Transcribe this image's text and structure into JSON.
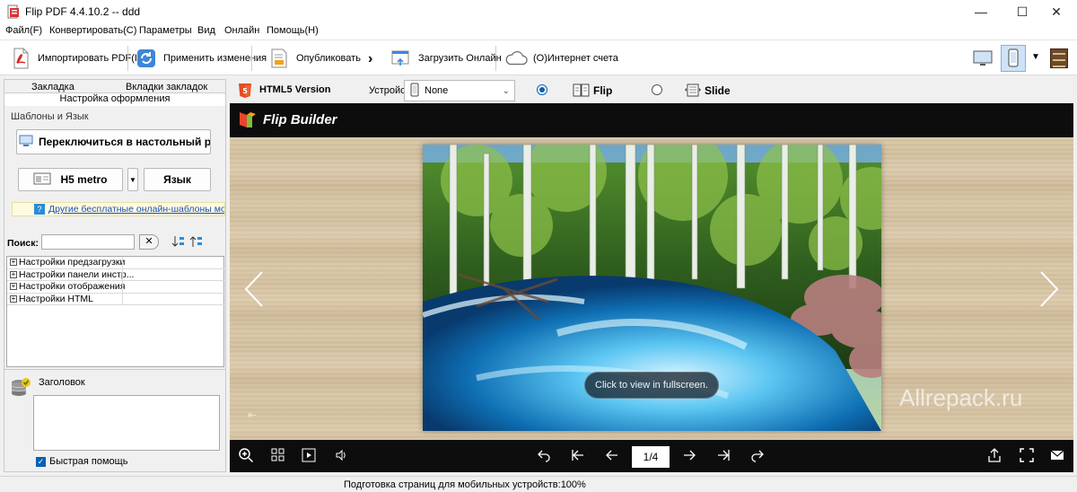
{
  "window": {
    "title": "Flip PDF 4.4.10.2 -- ddd",
    "minimize": "—",
    "maximize": "☐",
    "close": "✕"
  },
  "menu": [
    "Файл(F)",
    "Конвертировать(C)",
    "Параметры",
    "Вид",
    "Онлайн",
    "Помощь(H)"
  ],
  "toolbar": {
    "import_pdf": "Импортировать PDF(I)",
    "apply_changes": "Применить изменения",
    "publish": "Опубликовать",
    "upload_online": "Загрузить Онлайн",
    "online_account": "(O)Интернет счета"
  },
  "left_panel": {
    "tabs": [
      "Закладка",
      "Вкладки закладок",
      "Настройка оформления"
    ],
    "templates_group": "Шаблоны и Язык",
    "switch_desktop": "Переключиться в настольный реж",
    "template_name": "H5 metro",
    "language": "Язык",
    "online_templates_link": "Другие бесплатные онлайн-шаблоны можно н",
    "search_label": "Поиск:",
    "search_value": "",
    "tree": [
      "Настройки предзагрузки",
      "Настройки панели инстр...",
      "Настройки отображения",
      "Настройки HTML"
    ],
    "help_title": "Заголовок",
    "help_text": "",
    "quick_help": "Быстрая помощь",
    "quick_help_checked": true
  },
  "preview_settings": {
    "html5_version": "HTML5 Version",
    "device_label": "Устройст",
    "device_value": "None",
    "mode_flip": "Flip",
    "mode_slide": "Slide",
    "selected_mode": "Flip"
  },
  "flipbook": {
    "brand": "Flip Builder",
    "fullscreen_hint": "Click to view in fullscreen.",
    "watermark": "Allrepack.ru",
    "page_indicator": "1/4"
  },
  "status": {
    "text": "Подготовка страниц для мобильных устройств:100%"
  },
  "colors": {
    "accent_blue": "#0a5fb4",
    "header_black": "#0d0d0d",
    "link_blue": "#1a4fb5"
  }
}
